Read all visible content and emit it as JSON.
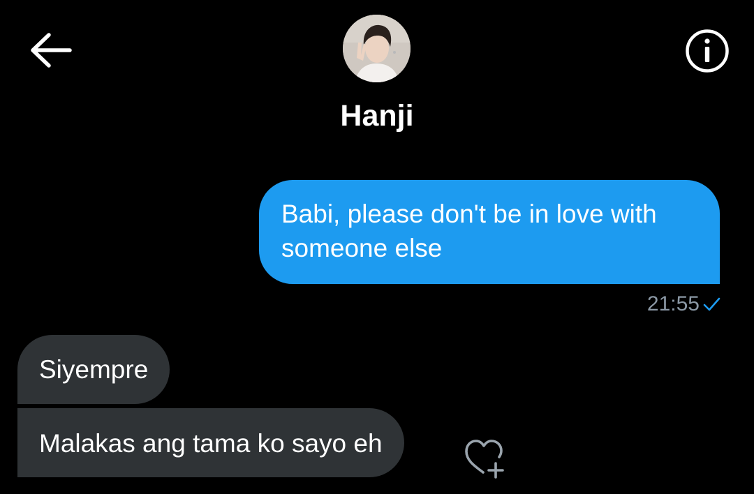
{
  "header": {
    "contact_name": "Hanji",
    "avatar_icon": "profile-photo",
    "back_icon": "arrow-left-icon",
    "info_icon": "info-circle-icon"
  },
  "messages": [
    {
      "direction": "sent",
      "text": "Babi, please don't be in love with someone else",
      "time": "21:55",
      "status_icon": "check-icon"
    },
    {
      "direction": "received",
      "text": "Siyempre"
    },
    {
      "direction": "received",
      "text": "Malakas ang tama ko sayo eh",
      "reaction_icon": "heart-plus-icon"
    }
  ],
  "colors": {
    "background": "#000000",
    "sent_bubble": "#1d9bf0",
    "received_bubble": "#2f3336",
    "timestamp": "#8b98a5",
    "text": "#ffffff"
  }
}
